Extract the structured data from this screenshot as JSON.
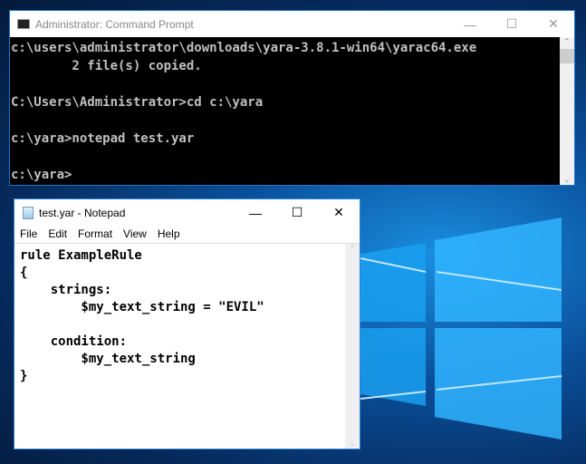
{
  "cmd": {
    "title": "Administrator: Command Prompt",
    "lines": [
      "c:\\users\\administrator\\downloads\\yara-3.8.1-win64\\yarac64.exe",
      "        2 file(s) copied.",
      "",
      "C:\\Users\\Administrator>cd c:\\yara",
      "",
      "c:\\yara>notepad test.yar",
      "",
      "c:\\yara>"
    ]
  },
  "notepad": {
    "title": "test.yar - Notepad",
    "menu": [
      "File",
      "Edit",
      "Format",
      "View",
      "Help"
    ],
    "lines": [
      "rule ExampleRule",
      "{",
      "    strings:",
      "        $my_text_string = \"EVIL\"",
      "",
      "    condition:",
      "        $my_text_string",
      "}"
    ]
  },
  "icons": {
    "minimize": "minimize-icon",
    "maximize": "maximize-icon",
    "close": "close-icon"
  }
}
